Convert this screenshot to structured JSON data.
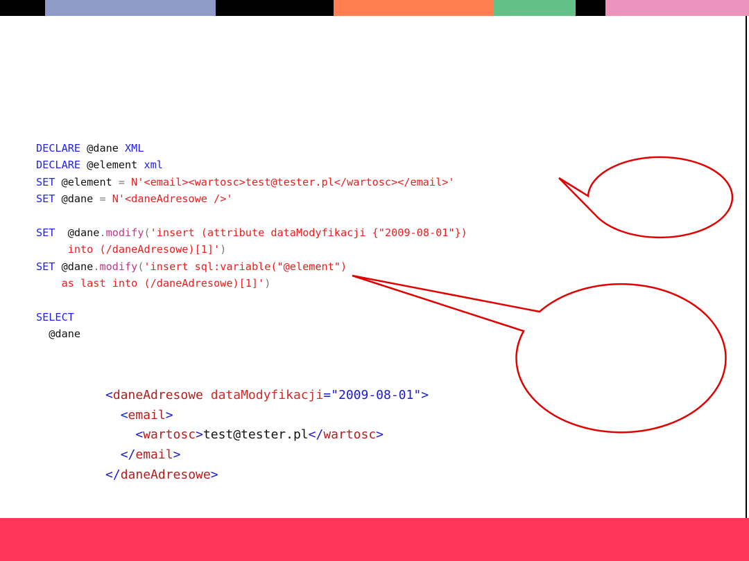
{
  "colors": {
    "top_bar": [
      "#000000",
      "#8f9ac9",
      "#000000",
      "#ff7f50",
      "#63c187",
      "#000000",
      "#ec93be"
    ],
    "bottom_band": "#ff3557",
    "callout_stroke": "#e00000",
    "sql_keyword": "#1f1ff0",
    "sql_string": "#ee1c1c",
    "sql_method": "#c0388c"
  },
  "code": {
    "l1": {
      "kw1": "DECLARE",
      "var": " @dane ",
      "kw2": "XML"
    },
    "l2": {
      "kw1": "DECLARE",
      "var": " @element ",
      "kw2": "xml"
    },
    "l3": {
      "kw": "SET",
      "var": " @element ",
      "op": "=",
      "str": " N'<email><wartosc>test@tester.pl</wartosc></email>'"
    },
    "l4": {
      "kw": "SET",
      "var": " @dane ",
      "op": "=",
      "str": " N'<daneAdresowe />'"
    },
    "l6": {
      "kw": "SET",
      "var": "  @dane",
      "dot": ".",
      "fn": "modify",
      "paren": "(",
      "str": "'insert (attribute dataModyfikacji {\"2009-08-01\"})"
    },
    "l7": {
      "indent": "     ",
      "str": "into (/daneAdresowe)[1]'",
      "paren": ")"
    },
    "l8": {
      "kw": "SET",
      "var": " @dane",
      "dot": ".",
      "fn": "modify",
      "paren": "(",
      "str": "'insert sql:variable(\"@element\")"
    },
    "l9": {
      "indent": "    ",
      "str": "as last into (/daneAdresowe)[1]'",
      "paren": ")"
    },
    "l11": {
      "kw": "SELECT"
    },
    "l12": {
      "text": "  @dane"
    }
  },
  "result": {
    "r1": {
      "open": "<",
      "tag": "daneAdresowe",
      "space": " ",
      "attr": "dataModyfikacji",
      "eq": "=",
      "val": "\"2009-08-01\"",
      "close": ">"
    },
    "r2": {
      "indent": "  ",
      "open": "<",
      "tag": "email",
      "close": ">"
    },
    "r3": {
      "indent": "    ",
      "open": "<",
      "tag": "wartosc",
      "close": ">",
      "text": "test@tester.pl",
      "open2": "</",
      "tag2": "wartosc",
      "close2": ">"
    },
    "r4": {
      "indent": "  ",
      "open": "</",
      "tag": "email",
      "close": ">"
    },
    "r5": {
      "open": "</",
      "tag": "daneAdresowe",
      "close": ">"
    }
  },
  "callouts": {
    "small_bubble": "",
    "large_bubble": ""
  }
}
